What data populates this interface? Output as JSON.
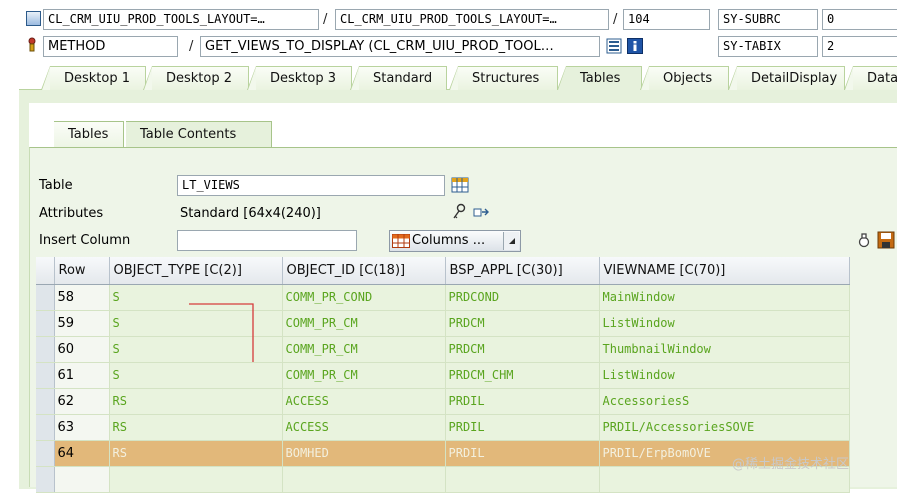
{
  "header": {
    "row1": {
      "program_field": "CL_CRM_UIU_PROD_TOOLS_LAYOUT=…",
      "class_field": "CL_CRM_UIU_PROD_TOOLS_LAYOUT=…",
      "line_field": "104",
      "sysvar_label": "SY-SUBRC",
      "sysvar_value": "0",
      "sep1": "/",
      "sep2": "/"
    },
    "row2": {
      "event_type": "METHOD",
      "event_name": "GET_VIEWS_TO_DISPLAY (CL_CRM_UIU_PROD_TOOL…",
      "sysvar_label": "SY-TABIX",
      "sysvar_value": "2",
      "sep1": "/"
    }
  },
  "outer_tabs": [
    {
      "label": "Desktop 1"
    },
    {
      "label": "Desktop 2"
    },
    {
      "label": "Desktop 3"
    },
    {
      "label": "Standard"
    },
    {
      "label": "Structures"
    },
    {
      "label": "Tables",
      "active": true
    },
    {
      "label": "Objects"
    },
    {
      "label": "DetailDisplay"
    },
    {
      "label": "Data"
    }
  ],
  "inner_tabs": [
    {
      "label": "Tables"
    },
    {
      "label": "Table Contents",
      "active": true
    }
  ],
  "form": {
    "table_label": "Table",
    "table_value": "LT_VIEWS",
    "attributes_label": "Attributes",
    "attributes_value": "Standard [64x4(240)]",
    "insert_column_label": "Insert Column",
    "insert_column_value": "",
    "columns_button": "Columns ..."
  },
  "grid": {
    "columns": [
      "Row",
      "OBJECT_TYPE [C(2)]",
      "OBJECT_ID [C(18)]",
      "BSP_APPL [C(30)]",
      "VIEWNAME [C(70)]"
    ],
    "rows": [
      {
        "row": "58",
        "object_type": "S",
        "object_id": "COMM_PR_COND",
        "bsp_appl": "PRDCOND",
        "viewname": "MainWindow"
      },
      {
        "row": "59",
        "object_type": "S",
        "object_id": "COMM_PR_CM",
        "bsp_appl": "PRDCM",
        "viewname": "ListWindow"
      },
      {
        "row": "60",
        "object_type": "S",
        "object_id": "COMM_PR_CM",
        "bsp_appl": "PRDCM",
        "viewname": "ThumbnailWindow"
      },
      {
        "row": "61",
        "object_type": "S",
        "object_id": "COMM_PR_CM",
        "bsp_appl": "PRDCM_CHM",
        "viewname": "ListWindow"
      },
      {
        "row": "62",
        "object_type": "RS",
        "object_id": "ACCESS",
        "bsp_appl": "PRDIL",
        "viewname": "AccessoriesS"
      },
      {
        "row": "63",
        "object_type": "RS",
        "object_id": "ACCESS",
        "bsp_appl": "PRDIL",
        "viewname": "PRDIL/AccessoriesSOVE"
      },
      {
        "row": "64",
        "object_type": "RS",
        "object_id": "BOMHED",
        "bsp_appl": "PRDIL",
        "viewname": "PRDIL/ErpBomOVE",
        "highlighted": true
      }
    ]
  },
  "watermark": "@稀土掘金技术社区",
  "colors": {
    "panel_green": "#e6f1dc",
    "cell_text_green": "#5aa51f",
    "highlight_row": "#e2b87a",
    "annotation_red": "#d63b3b"
  }
}
